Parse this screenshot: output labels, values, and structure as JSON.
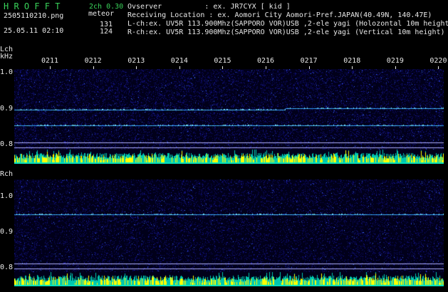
{
  "header": {
    "logo": "H R O F F T",
    "version": "2ch 0.30",
    "filename": "2505110210.png",
    "mode": "meteor",
    "datetime": "25.05.11 02:10",
    "lcount": "131",
    "rcount": "124",
    "observer": "Ovserver          : ex. JR7CYX [ kid ]",
    "location": "Receiving Location : ex. Aomori City Aomori-Pref.JAPAN(40.49N, 140.47E)",
    "lch": "L-ch:ex. UV5R 113.900Mhz(SAPPORO VOR)USB ,2-ele yagi (Holozontal 10m height)",
    "rch": "R-ch:ex. UV5R 113.900Mhz(SAPPORO VOR)USB ,2-ele yagi (Vertical 10m height)"
  },
  "time_axis": [
    "0211",
    "0212",
    "0213",
    "0214",
    "0215",
    "0216",
    "0217",
    "0218",
    "0219",
    "0220"
  ],
  "lch_panel": {
    "label": "Lch",
    "unit": "kHz",
    "ticks": [
      "1.0",
      "0.9",
      "0.8"
    ]
  },
  "rch_panel": {
    "label": "Rch",
    "ticks": [
      "1.0",
      "0.9",
      "0.8"
    ]
  },
  "colors": {
    "background": "#01001a",
    "noise": "#1a1a9a",
    "trace": "#5ad8ff",
    "bars_green": "#00e0c0",
    "bars_yellow": "#ffff00"
  }
}
